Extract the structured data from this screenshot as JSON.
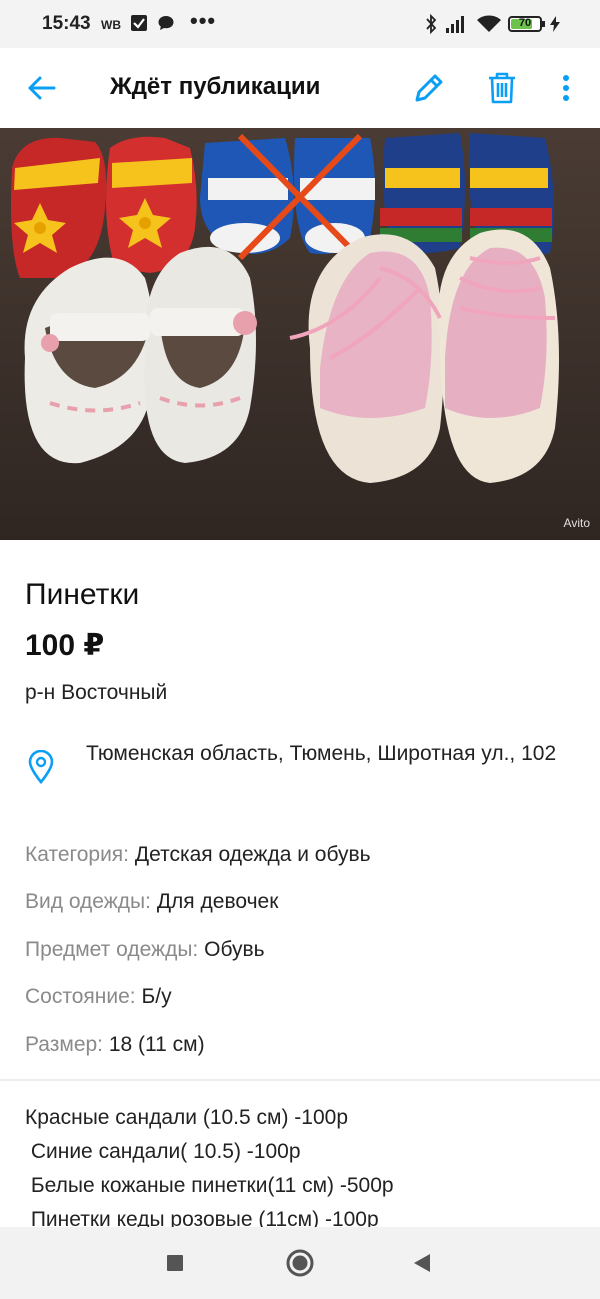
{
  "status_bar": {
    "time": "15:43",
    "carrier": "WB",
    "more": "•••",
    "battery_level": "70"
  },
  "app_bar": {
    "title": "Ждёт публикации"
  },
  "photo": {
    "watermark": "Avito"
  },
  "listing": {
    "title": "Пинетки",
    "price": "100 ₽",
    "district": "р-н Восточный",
    "address": "Тюменская область, Тюмень, Широтная ул., 102"
  },
  "params": [
    {
      "key": "Категория:",
      "value": "Детская одежда и обувь"
    },
    {
      "key": "Вид одежды:",
      "value": "Для девочек"
    },
    {
      "key": "Предмет одежды:",
      "value": "Обувь"
    },
    {
      "key": "Состояние:",
      "value": "Б/у"
    },
    {
      "key": "Размер:",
      "value": "18 (11 см)"
    }
  ],
  "description": "Красные сандали (10.5 см) -100р\n Синие сандали( 10.5) -100р\n Белые кожаные пинетки(11 см) -500р\n Пинетки кеды розовые (11см) -100р",
  "colors": {
    "accent": "#0a9ff5"
  }
}
